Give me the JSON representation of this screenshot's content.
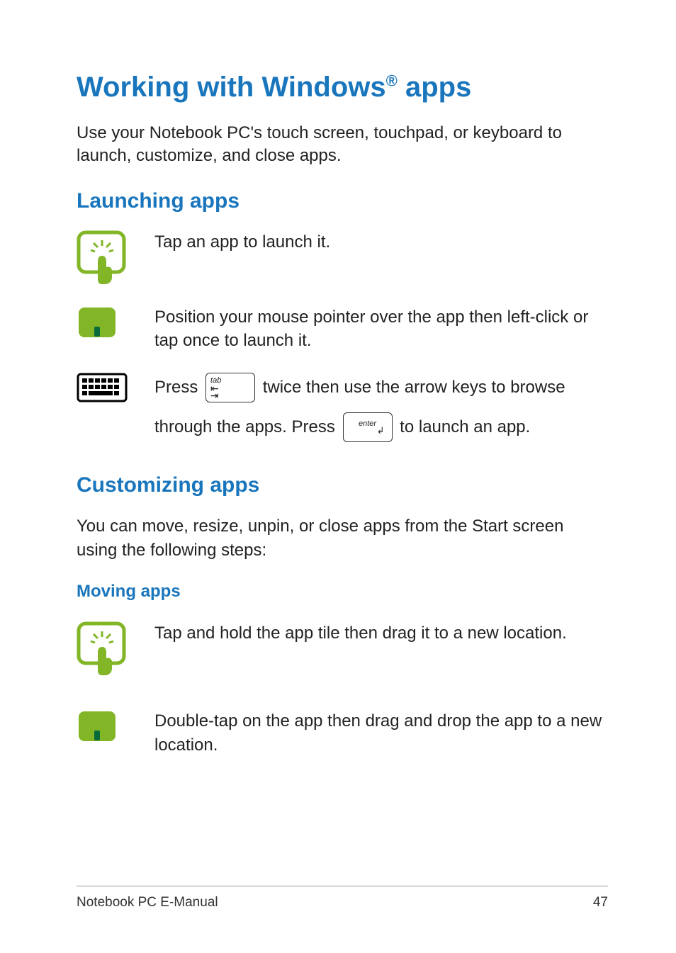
{
  "title_pre": "Working with Windows",
  "title_sup": "®",
  "title_post": " apps",
  "intro": "Use your Notebook PC's touch screen, touchpad, or keyboard to launch, customize, and close apps.",
  "launching": {
    "heading": "Launching apps",
    "touch": "Tap an app to launch it.",
    "touchpad": "Position your mouse pointer over the app then left-click or tap once to launch it.",
    "kb_pre": "Press ",
    "kb_mid": " twice then use the arrow keys to browse",
    "kb_line2_pre": "through the apps. Press ",
    "kb_line2_post": " to launch an app."
  },
  "customizing": {
    "heading": "Customizing apps",
    "intro": "You can move, resize, unpin, or close apps from the Start screen using the following steps:",
    "moving_heading": "Moving apps",
    "moving_touch": "Tap and hold the app tile then drag it to a new location.",
    "moving_touchpad": "Double-tap on the app then drag and drop the app to a new location."
  },
  "keys": {
    "tab_label": "tab",
    "enter_label": "enter"
  },
  "footer": {
    "left": "Notebook PC E-Manual",
    "right": "47"
  },
  "colors": {
    "heading": "#1976bd",
    "icon_green": "#82b627"
  }
}
